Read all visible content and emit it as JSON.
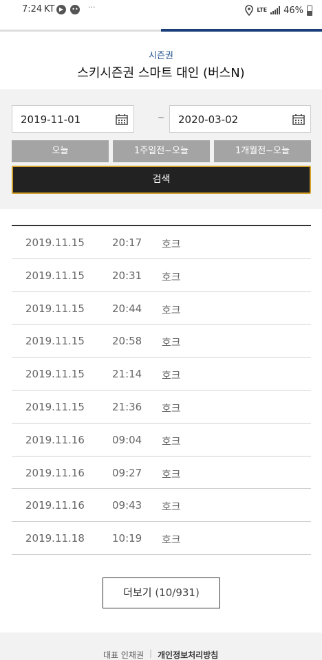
{
  "status_bar": {
    "time": "7:24",
    "carrier": "KT",
    "network": "LTE",
    "battery": "46%"
  },
  "header": {
    "category": "시즌권",
    "title": "스키시즌권 스마트 대인 (버스N)"
  },
  "search": {
    "start_date": "2019-11-01",
    "end_date": "2020-03-02",
    "separator": "~",
    "quick_buttons": [
      "오늘",
      "1주일전~오늘",
      "1개월전~오늘"
    ],
    "search_label": "검색"
  },
  "records": [
    {
      "date": "2019.11.15",
      "time": "20:17",
      "name": "호크"
    },
    {
      "date": "2019.11.15",
      "time": "20:31",
      "name": "호크"
    },
    {
      "date": "2019.11.15",
      "time": "20:44",
      "name": "호크"
    },
    {
      "date": "2019.11.15",
      "time": "20:58",
      "name": "호크"
    },
    {
      "date": "2019.11.15",
      "time": "21:14",
      "name": "호크"
    },
    {
      "date": "2019.11.15",
      "time": "21:36",
      "name": "호크"
    },
    {
      "date": "2019.11.16",
      "time": "09:04",
      "name": "호크"
    },
    {
      "date": "2019.11.16",
      "time": "09:27",
      "name": "호크"
    },
    {
      "date": "2019.11.16",
      "time": "09:43",
      "name": "호크"
    },
    {
      "date": "2019.11.18",
      "time": "10:19",
      "name": "호크"
    }
  ],
  "more": {
    "label": "더보기",
    "count": "(10/931)"
  },
  "footer": {
    "representative": "대표 인채권",
    "privacy": "개인정보처리방침"
  },
  "colors": {
    "accent_blue": "#1c4f8c",
    "search_border": "#d4a12b",
    "quick_button": "#a4a4a4"
  }
}
